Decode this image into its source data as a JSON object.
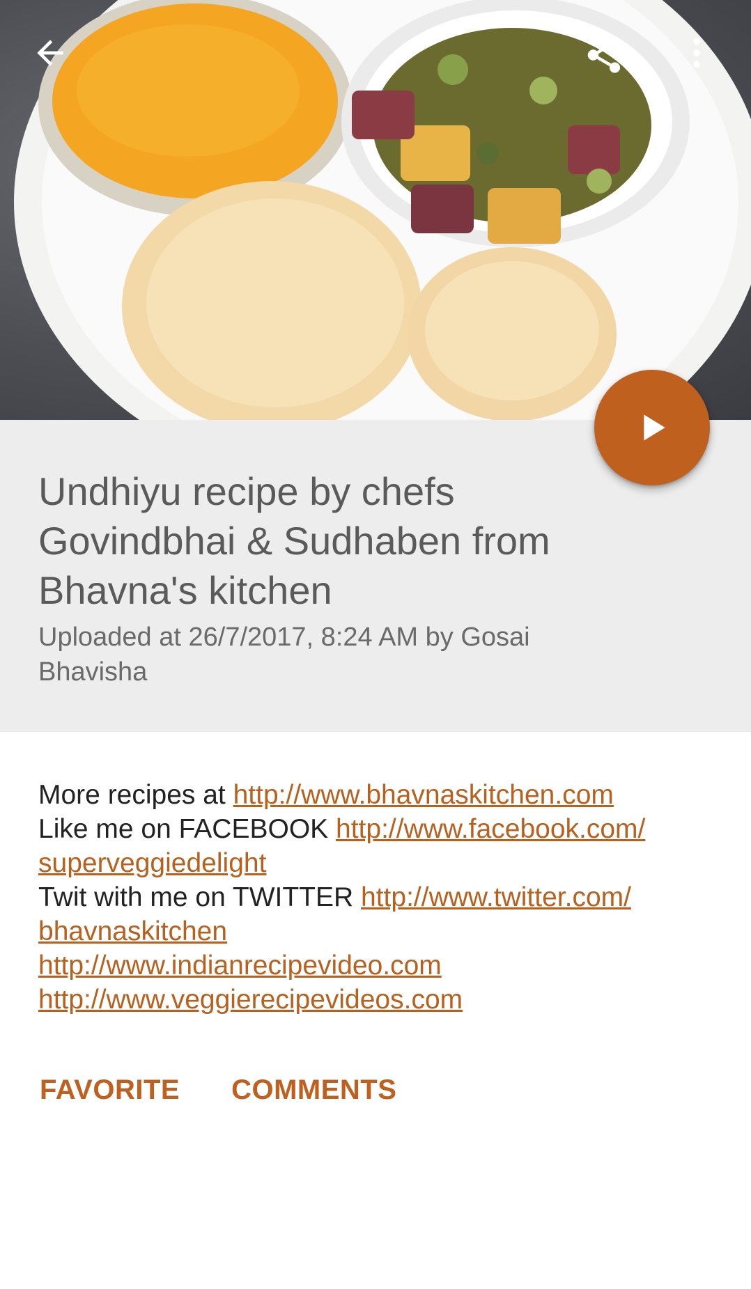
{
  "toolbar": {
    "back_icon": "arrow-back-icon",
    "share_icon": "share-icon",
    "menu_icon": "more-vert-icon"
  },
  "hero": {
    "image_alt": "food-photo",
    "play_icon": "play-icon"
  },
  "video": {
    "title": "Undhiyu recipe by chefs Govindbhai & Sudhaben from Bhavna's kitchen",
    "upload_info": "Uploaded at 26/7/2017, 8:24 AM by Gosai Bhavisha"
  },
  "description": {
    "line1_text": "More recipes at ",
    "line1_link": "http://www.bhavnaskitchen.com",
    "line2_text": "Like me on FACEBOOK ",
    "line2_link_a": "http://www.facebook.com/",
    "line2_link_b": "superveggiedelight",
    "line3_text": "Twit with me on TWITTER ",
    "line3_link_a": "http://www.twitter.com/",
    "line3_link_b": "bhavnaskitchen",
    "line4_link": "http://www.indianrecipevideo.com",
    "line5_link": "http://www.veggierecipevideos.com"
  },
  "actions": {
    "favorite": "FAVORITE",
    "comments": "COMMENTS"
  },
  "colors": {
    "accent": "#c0601e",
    "link": "#b8611e",
    "header_bg": "#ededed"
  }
}
